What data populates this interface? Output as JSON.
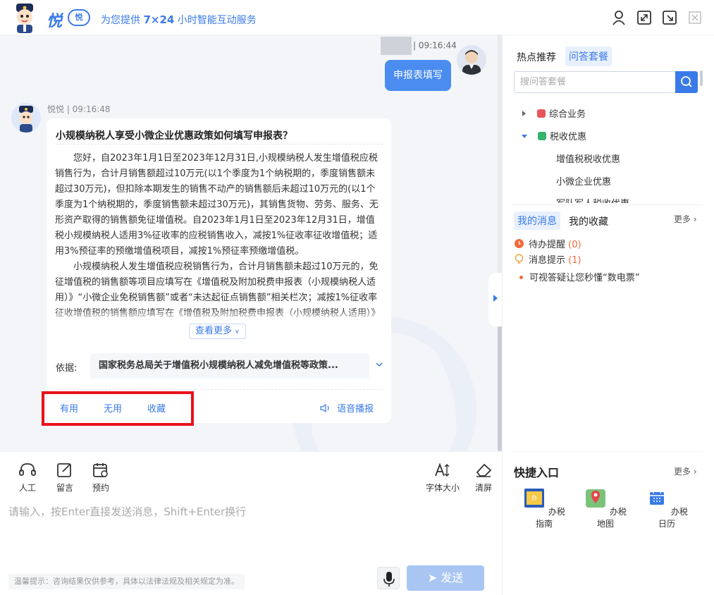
{
  "header": {
    "brand": "悦",
    "brand_badge": "悦",
    "slogan_prefix": "为您提供 ",
    "slogan_bold": "7×24",
    "slogan_suffix": " 小时智能互动服务",
    "icons": [
      "user-icon",
      "expand-icon",
      "exit-icon",
      "close-icon"
    ]
  },
  "chat": {
    "user_time": "09:16:44",
    "user_message": "申报表填写",
    "bot_meta": "悦悦 | 09:16:48",
    "question": "小规模纳税人享受小微企业优惠政策如何填写申报表？",
    "answer_p1": "您好，自2023年1月1日至2023年12月31日,小规模纳税人发生增值税应税销售行为，合计月销售额超过10万元(以1个季度为1个纳税期的，季度销售额未超过30万元)，但扣除本期发生的销售不动产的销售额后未超过10万元的(以1个季度为1个纳税期的，季度销售额未超过30万元)，其销售货物、劳务、服务、无形资产取得的销售额免征增值税。自2023年1月1日至2023年12月31日，增值税小规模纳税人适用3%征收率的应税销售收入，减按1%征收率征收增值税；适用3%预征率的预缴增值税项目，减按1%预征率预缴增值税。",
    "answer_p2": "小规模纳税人发生增值税应税销售行为，合计月销售额未超过10万元的，免征增值税的销售额等项目应填写在《增值税及附加税费申报表（小规模纳税人适用）》“小微企业免税销售额”或者“未达起征点销售额”相关栏次；减按1%征收率征收增值税的销售额应填写在《增值税及附加税费申报表（小规模纳税人适用）》相应栏次。",
    "more_label": "查看更多",
    "basis_label": "依据:",
    "basis_value": "国家税务总局关于增值税小规模纳税人减免增值税等政策...",
    "feedback": [
      "有用",
      "无用",
      "收藏"
    ],
    "tts_label": "语音播报"
  },
  "toolbar": {
    "tools_left": [
      "人工",
      "留言",
      "预约"
    ],
    "tools_right": [
      "字体大小",
      "清屏"
    ],
    "placeholder": "请输入，按Enter直接发送消息，Shift+Enter换行",
    "tip": "温馨提示：咨询结果仅供参考，具体以法律法规及相关规定为准。",
    "send_label": "发送"
  },
  "right": {
    "tabs": [
      "热点推荐",
      "问答套餐"
    ],
    "active_tab": "问答套餐",
    "search_placeholder": "搜问答套餐",
    "tree": [
      {
        "label": "综合业务",
        "level": 0,
        "expanded": false,
        "color": "#e8565a"
      },
      {
        "label": "税收优惠",
        "level": 0,
        "expanded": true,
        "color": "#35b36b"
      },
      {
        "label": "增值税税收优惠",
        "level": 1
      },
      {
        "label": "小微企业优惠",
        "level": 1
      },
      {
        "label": "军队军人税收优惠",
        "level": 1
      }
    ],
    "msg_tabs": [
      "我的消息",
      "我的收藏"
    ],
    "more_label": "更多",
    "messages": [
      {
        "label": "待办提醒",
        "count": "(0)"
      },
      {
        "label": "消息提示",
        "count": "(1)"
      }
    ],
    "notice": "可视答疑让您秒懂“数电票”",
    "quick_title": "快捷入口",
    "quick_items": [
      "办税指南",
      "办税地图",
      "办税日历"
    ],
    "accent": "#3a7ae8"
  }
}
